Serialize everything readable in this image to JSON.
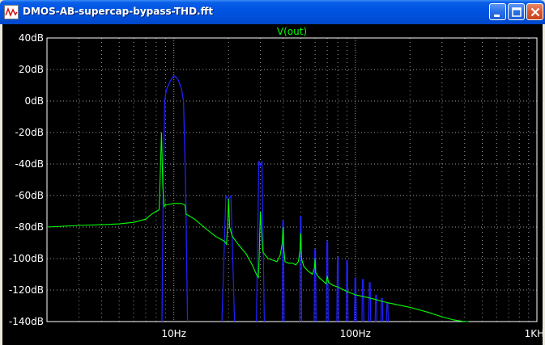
{
  "window": {
    "title": "DMOS-AB-supercap-bypass-THD.fft",
    "colors": {
      "titlebar": "#0054E3",
      "plot_bg": "#000000",
      "grid": "#9A9A9A"
    }
  },
  "chart_data": {
    "type": "line",
    "title": "V(out)",
    "title_color": "#00FF00",
    "xscale": "log",
    "xlim": [
      2,
      1000
    ],
    "ylim": [
      -140,
      40
    ],
    "x_ticks": [
      {
        "value": 10,
        "label": "10Hz"
      },
      {
        "value": 100,
        "label": "100Hz"
      },
      {
        "value": 1000,
        "label": "1KHz"
      }
    ],
    "y_ticks": [
      {
        "value": 40,
        "label": "40dB"
      },
      {
        "value": 20,
        "label": "20dB"
      },
      {
        "value": 0,
        "label": "0dB"
      },
      {
        "value": -20,
        "label": "-20dB"
      },
      {
        "value": -40,
        "label": "-40dB"
      },
      {
        "value": -60,
        "label": "-60dB"
      },
      {
        "value": -80,
        "label": "-80dB"
      },
      {
        "value": -100,
        "label": "-100dB"
      },
      {
        "value": -120,
        "label": "-120dB"
      },
      {
        "value": -140,
        "label": "-140dB"
      }
    ],
    "grid": true,
    "series": [
      {
        "color": "#00FF00",
        "x": [
          2,
          3,
          4,
          5,
          6,
          7,
          7.5,
          8,
          8.3,
          8.4,
          8.55,
          8.7,
          8.85,
          9,
          10,
          11,
          11.5,
          11.7,
          12,
          13,
          15,
          17,
          19,
          19.5,
          19.8,
          20,
          20.3,
          21,
          23,
          25,
          27,
          28.5,
          29.2,
          29.5,
          29.8,
          30,
          30.3,
          31,
          33,
          35,
          37,
          38.5,
          39.5,
          40,
          40.4,
          41,
          43,
          45,
          47,
          48.5,
          49.5,
          50,
          50.5,
          52,
          55,
          58,
          59.5,
          60,
          60.5,
          63,
          66,
          69,
          70,
          71,
          75,
          80,
          90,
          100,
          120,
          150,
          200,
          250,
          300,
          350,
          400,
          420
        ],
        "y": [
          -80,
          -79,
          -78.5,
          -78,
          -77,
          -75,
          -72,
          -70,
          -69,
          -50,
          -20,
          -55,
          -67,
          -66,
          -65,
          -65,
          -66,
          -72,
          -72.5,
          -75,
          -81,
          -86,
          -89,
          -91,
          -79,
          -62,
          -80,
          -86,
          -92,
          -97,
          -104,
          -110,
          -112,
          -100,
          -80,
          -70,
          -80,
          -96,
          -100,
          -101,
          -102,
          -98,
          -91,
          -80,
          -95,
          -102,
          -103,
          -103,
          -104,
          -102,
          -95,
          -84,
          -100,
          -105,
          -108,
          -110,
          -106,
          -100,
          -109,
          -112,
          -114,
          -116,
          -111,
          -115,
          -117,
          -118,
          -121,
          -123,
          -125,
          -128,
          -131,
          -134,
          -137,
          -139,
          -140,
          -140
        ]
      }
    ],
    "spikes": {
      "color": "#2020FF",
      "lobe": {
        "x": [
          8.6,
          8.75,
          8.9,
          9.1,
          9.4,
          9.7,
          10,
          10.3,
          10.6,
          11,
          11.3,
          11.6,
          11.9
        ],
        "y": [
          -140,
          -50,
          0,
          7,
          11,
          14,
          16,
          15,
          13,
          8,
          0,
          -50,
          -140
        ]
      },
      "harmonics": [
        {
          "x": 20,
          "top": -63,
          "width": 0.08
        },
        {
          "x": 30,
          "top": -41,
          "width": 0.05
        },
        {
          "x": 40,
          "top": -79
        },
        {
          "x": 50,
          "top": -76
        },
        {
          "x": 60,
          "top": -97
        },
        {
          "x": 70,
          "top": -92
        },
        {
          "x": 80,
          "top": -102
        },
        {
          "x": 90,
          "top": -104
        },
        {
          "x": 100,
          "top": -115
        },
        {
          "x": 110,
          "top": -116
        },
        {
          "x": 120,
          "top": -118
        },
        {
          "x": 130,
          "top": -126
        },
        {
          "x": 140,
          "top": -128
        },
        {
          "x": 150,
          "top": -131
        }
      ]
    }
  }
}
